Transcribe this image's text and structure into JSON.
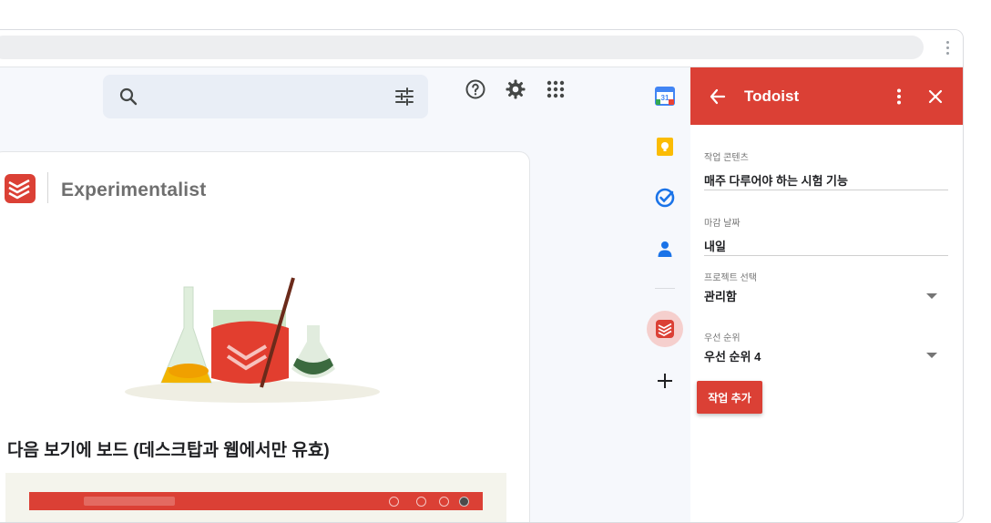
{
  "gmail": {
    "search": {
      "placeholder": ""
    },
    "card": {
      "brand": "Experimentalist",
      "headline": "다음 보기에 보드 (데스크탑과 웹에서만 유효)"
    }
  },
  "todoist_panel": {
    "title": "Todoist",
    "fields": [
      {
        "label": "작업 콘텐츠",
        "value": "매주 다루어야 하는 시험 기능"
      },
      {
        "label": "마감 날짜",
        "value": "내일"
      },
      {
        "label": "프로젝트 선택",
        "value": "관리함"
      },
      {
        "label": "우선 순위",
        "value": "우선 순위 4"
      }
    ],
    "add_button": "작업 추가"
  },
  "colors": {
    "brand_red": "#db4035",
    "gmail_bg": "#f6f8fc",
    "search_bg": "#e9eef6"
  },
  "icons": [
    "search-icon",
    "tune-icon",
    "help-icon",
    "gear-icon",
    "apps-grid-icon",
    "calendar-icon",
    "keep-icon",
    "tasks-icon",
    "contacts-icon",
    "todoist-icon",
    "plus-icon",
    "back-arrow-icon",
    "more-vert-icon",
    "close-icon",
    "chevron-down-icon"
  ]
}
